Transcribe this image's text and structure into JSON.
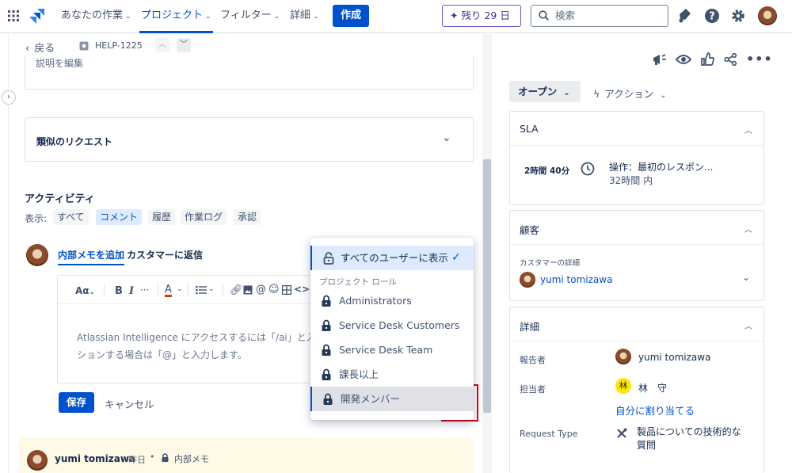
{
  "nav": {
    "your_work": "あなたの作業",
    "projects": "プロジェクト",
    "filters": "フィルター",
    "more": "詳細",
    "create": "作成",
    "trial": "残り 29 日",
    "search_placeholder": "検索"
  },
  "breadcrumb": {
    "back": "戻る",
    "issue_key": "HELP-1225"
  },
  "description": {
    "placeholder": "説明を編集"
  },
  "similar": {
    "title": "類似のリクエスト"
  },
  "activity": {
    "title": "アクティビティ",
    "show_label": "表示:",
    "filters": [
      "すべて",
      "コメント",
      "履歴",
      "作業ログ",
      "承認"
    ],
    "selected_filter": "コメント"
  },
  "comment": {
    "tab_internal": "内部メモを追加",
    "tab_reply": "カスタマーに返信",
    "placeholder_line1": "Atlassian Intelligence にアクセスするには「/ai」と入力",
    "placeholder_line2": "ションする場合は「@」と入力します。",
    "save": "保存",
    "cancel": "キャンセル",
    "toolbar": {
      "text_style": "Aα",
      "bold": "B",
      "italic": "I",
      "more": "···",
      "color": "A"
    }
  },
  "restriction_menu": {
    "all_users": "すべてのユーザーに表示",
    "section_label": "プロジェクト ロール",
    "roles": [
      "Administrators",
      "Service Desk Customers",
      "Service Desk Team",
      "課長以上",
      "開発メンバー"
    ],
    "highlighted_role": "開発メンバー"
  },
  "prev_comment": {
    "author": "yumi tomizawa",
    "time": "昨日",
    "type": "内部メモ"
  },
  "status": {
    "label": "オープン",
    "actions": "アクション"
  },
  "sla": {
    "title": "SLA",
    "remaining": "2時間 40分",
    "goal": "操作：最初のレスポン...",
    "within": "32時間 内"
  },
  "customer": {
    "title": "顧客",
    "details_label": "カスタマーの詳細",
    "name": "yumi tomizawa"
  },
  "details": {
    "title": "詳細",
    "reporter_label": "報告者",
    "reporter": "yumi tomizawa",
    "assignee_label": "担当者",
    "assignee": "林　守",
    "assignee_initial": "林",
    "assign_to_me": "自分に割り当てる",
    "request_type_label": "Request Type",
    "request_type_line1": "製品についての技術的な",
    "request_type_line2": "質問"
  },
  "colors": {
    "brand": "#0052cc",
    "trial_border": "#6554c0",
    "highlight_box": "#e2001a",
    "note_bg": "#fffae6"
  }
}
